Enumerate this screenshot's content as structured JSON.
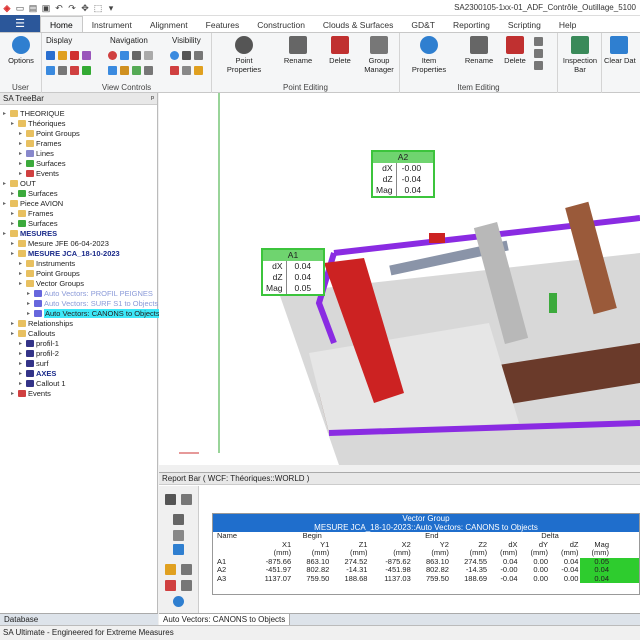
{
  "window": {
    "title": "SA2300105-1xx-01_ADF_Contrôle_Outillage_5100"
  },
  "tabs": [
    "Home",
    "Instrument",
    "Alignment",
    "Features",
    "Construction",
    "Clouds & Surfaces",
    "GD&T",
    "Reporting",
    "Scripting",
    "Help"
  ],
  "ribbon": {
    "user": {
      "options_label": "Options",
      "group_label": "User"
    },
    "view_controls": {
      "display": "Display",
      "navigation": "Navigation",
      "visibility": "Visibility",
      "group_label": "View Controls"
    },
    "point_editing": {
      "point_properties": "Point Properties",
      "rename": "Rename",
      "delete": "Delete",
      "group_manager": "Group Manager",
      "group_label": "Point Editing"
    },
    "item_editing": {
      "item_properties": "Item Properties",
      "rename": "Rename",
      "delete": "Delete",
      "group_label": "Item Editing"
    },
    "inspection_bar": "Inspection Bar",
    "clear_data": "Clear Dat"
  },
  "treebar": {
    "title": "SA TreeBar",
    "pin": "ᵖ",
    "items": [
      {
        "label": "THEORIQUE",
        "level": 0,
        "icon": "#e8c060",
        "bold": false
      },
      {
        "label": "Théoriques",
        "level": 1,
        "icon": "#e8c060"
      },
      {
        "label": "Point Groups",
        "level": 2,
        "icon": "#e8c060"
      },
      {
        "label": "Frames",
        "level": 2,
        "icon": "#e8c060"
      },
      {
        "label": "Lines",
        "level": 2,
        "icon": "#8888cc"
      },
      {
        "label": "Surfaces",
        "level": 2,
        "icon": "#3caa3c"
      },
      {
        "label": "Events",
        "level": 2,
        "icon": "#d04040"
      },
      {
        "label": "OUT",
        "level": 0,
        "icon": "#e8c060"
      },
      {
        "label": "Surfaces",
        "level": 1,
        "icon": "#3caa3c"
      },
      {
        "label": "Piece AVION",
        "level": 0,
        "icon": "#e8c060"
      },
      {
        "label": "Frames",
        "level": 1,
        "icon": "#e8c060"
      },
      {
        "label": "Surfaces",
        "level": 1,
        "icon": "#3caa3c"
      },
      {
        "label": "MESURES",
        "level": 0,
        "icon": "#e8c060",
        "bold": true
      },
      {
        "label": "Mesure JFE 06-04-2023",
        "level": 1,
        "icon": "#e8c060"
      },
      {
        "label": "MESURE JCA_18-10-2023",
        "level": 1,
        "icon": "#e8c060",
        "bold": true
      },
      {
        "label": "Instruments",
        "level": 2,
        "icon": "#e8c060"
      },
      {
        "label": "Point Groups",
        "level": 2,
        "icon": "#e8c060"
      },
      {
        "label": "Vector Groups",
        "level": 2,
        "icon": "#e8c060"
      },
      {
        "label": "Auto Vectors: PROFIL PEIGNES",
        "level": 3,
        "icon": "#6666dd",
        "faded": true
      },
      {
        "label": "Auto Vectors: SURF S1 to Objects",
        "level": 3,
        "icon": "#6666dd",
        "faded": true
      },
      {
        "label": "Auto Vectors: CANONS to Objects",
        "level": 3,
        "icon": "#6666dd",
        "selected": true
      },
      {
        "label": "Relationships",
        "level": 1,
        "icon": "#e8c060"
      },
      {
        "label": "Callouts",
        "level": 1,
        "icon": "#e8c060"
      },
      {
        "label": "profil-1",
        "level": 2,
        "icon": "#333388"
      },
      {
        "label": "profil-2",
        "level": 2,
        "icon": "#333388"
      },
      {
        "label": "surf",
        "level": 2,
        "icon": "#333388"
      },
      {
        "label": "AXES",
        "level": 2,
        "icon": "#333388",
        "bold": true
      },
      {
        "label": "Callout 1",
        "level": 2,
        "icon": "#333388"
      },
      {
        "label": "Events",
        "level": 1,
        "icon": "#d04040"
      }
    ],
    "footer": "Database"
  },
  "callouts": [
    {
      "name": "A2",
      "rows": [
        [
          "dX",
          "-0.00"
        ],
        [
          "dZ",
          "-0.04"
        ],
        [
          "Mag",
          "0.04"
        ]
      ]
    },
    {
      "name": "A1",
      "rows": [
        [
          "dX",
          "0.04"
        ],
        [
          "dZ",
          "0.04"
        ],
        [
          "Mag",
          "0.05"
        ]
      ]
    }
  ],
  "report": {
    "title": "Report Bar  ( WCF: Théoriques::WORLD )",
    "table_title": "Vector Group",
    "table_subtitle": "MESURE JCA_18-10-2023::Auto Vectors: CANONS to Objects",
    "headers": {
      "name": "Name",
      "begin": "Begin",
      "end": "End",
      "delta": "Delta"
    },
    "columns": [
      "X1",
      "Y1",
      "Z1",
      "X2",
      "Y2",
      "Z2",
      "dX",
      "dY",
      "dZ",
      "Mag"
    ],
    "units": "(mm)",
    "rows": [
      {
        "name": "A1",
        "values": [
          "-875.66",
          "863.10",
          "274.52",
          "-875.62",
          "863.10",
          "274.55",
          "0.04",
          "0.00",
          "0.04",
          "0.05"
        ]
      },
      {
        "name": "A2",
        "values": [
          "-451.97",
          "802.82",
          "-14.31",
          "-451.98",
          "802.82",
          "-14.35",
          "-0.00",
          "0.00",
          "-0.04",
          "0.04"
        ]
      },
      {
        "name": "A3",
        "values": [
          "1137.07",
          "759.50",
          "188.68",
          "1137.03",
          "759.50",
          "188.69",
          "-0.04",
          "0.00",
          "0.00",
          "0.04"
        ]
      }
    ],
    "footer_tab": "Auto Vectors: CANONS to Objects"
  },
  "status": "SA Ultimate - Engineered for Extreme Measures",
  "colors": {
    "accent": "#2b579a",
    "callout_green": "#3cc43c",
    "header_blue": "#1f6ecc"
  }
}
